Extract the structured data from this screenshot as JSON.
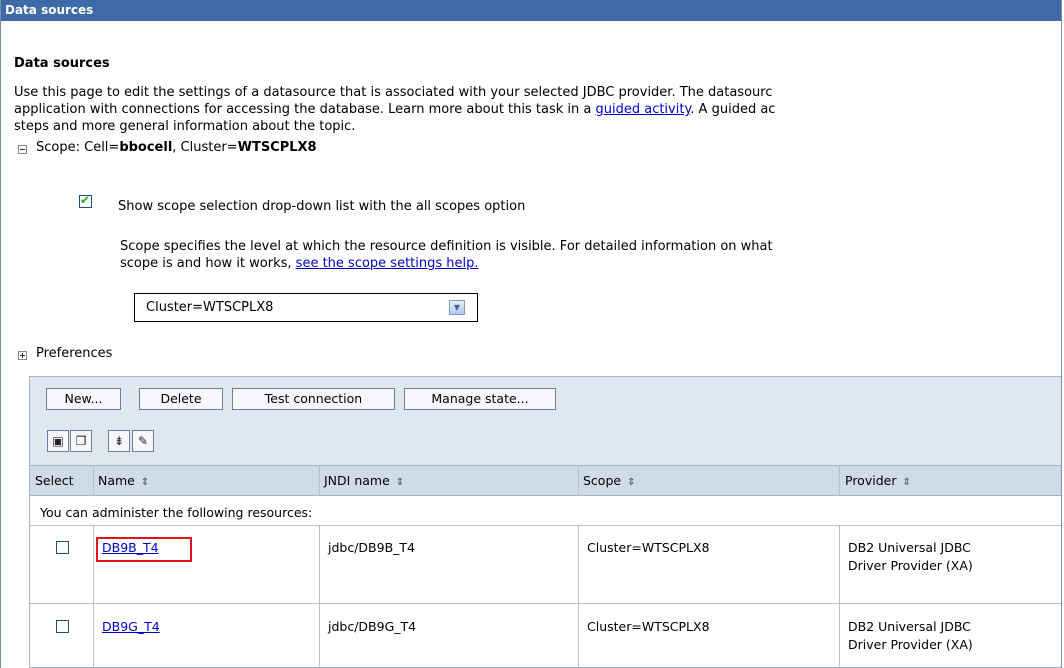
{
  "window": {
    "title": "Data sources"
  },
  "page": {
    "heading": "Data sources",
    "description": [
      "Use this page to edit the settings of a datasource that is associated with your selected JDBC provider. The datasourc",
      "application with connections for accessing the database. Learn more about this task in a ",
      "guided activity",
      ". A guided ac",
      "steps and more general information about the topic."
    ]
  },
  "scope": {
    "prefix": "Scope: Cell=",
    "cell": "bbocell",
    "cluster_prefix": ", Cluster=",
    "cluster": "WTSCPLX8",
    "show_dropdown_label": "Show scope selection drop-down list with the all scopes option",
    "show_dropdown_checked": true,
    "help_line1": "Scope specifies the level at which the resource definition is visible. For detailed information on what",
    "help_line2": "scope is and how it works, ",
    "help_link": "see the scope settings help.",
    "selected": "Cluster=WTSCPLX8"
  },
  "preferences": {
    "label": "Preferences"
  },
  "toolbar": {
    "new_label": "New...",
    "delete_label": "Delete",
    "test_label": "Test connection",
    "manage_label": "Manage state..."
  },
  "icons": [
    "select-all-icon",
    "deselect-all-icon",
    "show-filter-icon",
    "clear-filter-icon"
  ],
  "table": {
    "headers": {
      "select": "Select",
      "name": "Name",
      "jndi": "JNDI name",
      "scope": "Scope",
      "provider": "Provider"
    },
    "group_label": "You can administer the following resources:",
    "rows": [
      {
        "name": "DB9B_T4",
        "jndi": "jdbc/DB9B_T4",
        "scope": "Cluster=WTSCPLX8",
        "provider1": "DB2 Universal JDBC",
        "provider2": "Driver Provider (XA)",
        "highlighted": true
      },
      {
        "name": "DB9G_T4",
        "jndi": "jdbc/DB9G_T4",
        "scope": "Cluster=WTSCPLX8",
        "provider1": "DB2 Universal JDBC",
        "provider2": "Driver Provider (XA)",
        "highlighted": false
      }
    ]
  },
  "colors": {
    "titlebar": "#3f6aa8",
    "link": "#0000cc",
    "highlight": "#e2131b",
    "header_bg": "#d0dbe8"
  }
}
